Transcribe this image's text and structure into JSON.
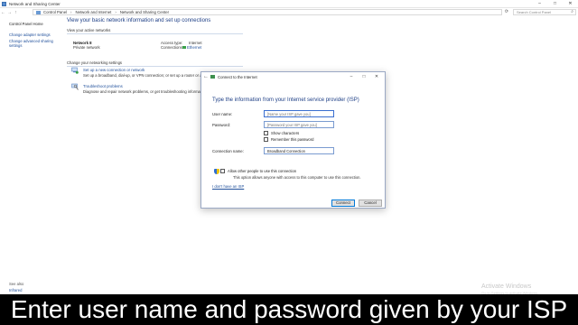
{
  "window": {
    "title": "Network and Sharing Center",
    "controls": [
      "–",
      "□",
      "✕"
    ]
  },
  "address_bar": {
    "crumbs": [
      "Control Panel",
      "Network and Internet",
      "Network and Sharing Center"
    ],
    "search_placeholder": "Search Control Panel",
    "icons": [
      "back-arrow-icon",
      "forward-arrow-icon",
      "up-arrow-icon",
      "refresh-icon",
      "search-icon"
    ]
  },
  "left_pane": {
    "home": "Control Panel Home",
    "links": [
      "Change adapter settings",
      "Change advanced sharing settings"
    ],
    "see_also": "See also",
    "see_also_links": [
      "Infrared"
    ]
  },
  "main": {
    "heading": "View your basic network information and set up connections",
    "active_networks_label": "View your active networks",
    "network": {
      "name": "Network 8",
      "type": "Private network",
      "access_type_label": "Access type:",
      "access_type_value": "Internet",
      "connections_label": "Connections:",
      "connections_value": "Ethernet"
    },
    "change_settings_label": "Change your networking settings",
    "tasks": [
      {
        "title": "Set up a new connection or network",
        "desc": "Set up a broadband, dial-up, or VPN connection; or set up a router or access point."
      },
      {
        "title": "Troubleshoot problems",
        "desc": "Diagnose and repair network problems, or get troubleshooting information."
      }
    ]
  },
  "dialog": {
    "title": "Connect to the Internet",
    "controls": [
      "–",
      "□",
      "✕"
    ],
    "heading": "Type the information from your Internet service provider (ISP)",
    "username_label": "User name:",
    "username_placeholder": "[Name your ISP gave you]",
    "password_label": "Password:",
    "password_placeholder": "[Password your ISP gave you]",
    "show_characters": "Show characters",
    "remember_password": "Remember this password",
    "connection_name_label": "Connection name:",
    "connection_name_value": "Broadband Connection",
    "allow_others": "Allow other people to use this connection",
    "allow_others_desc": "This option allows anyone with access to this computer to use this connection.",
    "no_isp_link": "I don't have an ISP",
    "connect_button": "Connect",
    "cancel_button": "Cancel"
  },
  "watermark": {
    "title": "Activate Windows",
    "subtitle": "Go to Settings to activate Windows."
  },
  "caption": "Enter user name and password given by your ISP"
}
